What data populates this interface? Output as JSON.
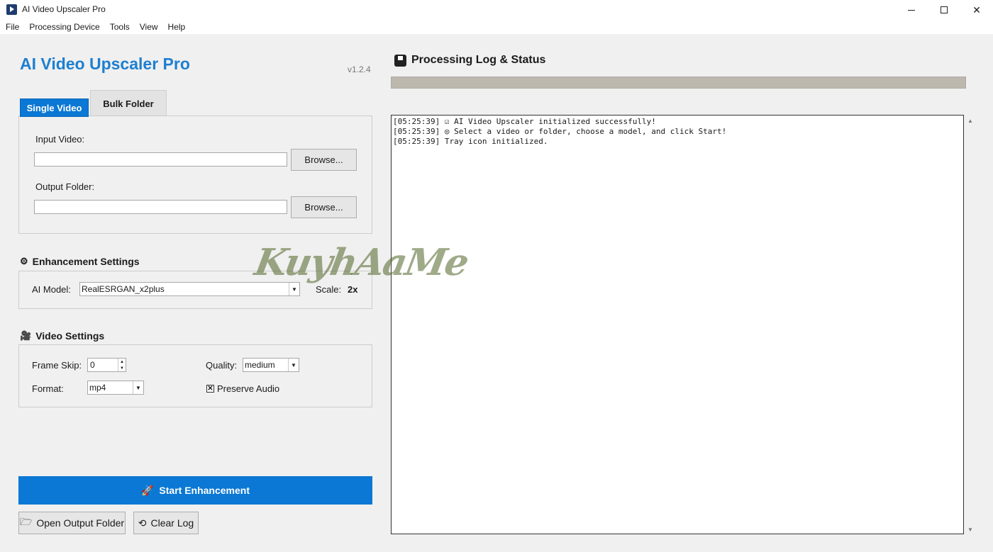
{
  "window": {
    "title": "AI Video Upscaler Pro"
  },
  "menu": [
    "File",
    "Processing Device",
    "Tools",
    "View",
    "Help"
  ],
  "header": {
    "title": "AI Video Upscaler Pro",
    "version": "v1.2.4"
  },
  "tabs": {
    "single": "Single Video",
    "bulk": "Bulk Folder"
  },
  "files": {
    "input_label": "Input Video:",
    "input_value": "",
    "output_label": "Output Folder:",
    "output_value": "",
    "browse_label": "Browse..."
  },
  "enhancement": {
    "title": "Enhancement Settings",
    "model_label": "AI Model:",
    "model_value": "RealESRGAN_x2plus",
    "scale_label": "Scale:",
    "scale_value": "2x"
  },
  "video": {
    "title": "Video Settings",
    "frame_skip_label": "Frame Skip:",
    "frame_skip_value": "0",
    "quality_label": "Quality:",
    "quality_value": "medium",
    "format_label": "Format:",
    "format_value": "mp4",
    "preserve_audio_label": "Preserve Audio",
    "preserve_audio_checked": true
  },
  "actions": {
    "start": "Start Enhancement",
    "open_output": "Open Output Folder",
    "clear_log": "Clear Log"
  },
  "log": {
    "title": "Processing Log & Status",
    "progress": 0,
    "lines": [
      "[05:25:39] ☑ AI Video Upscaler initialized successfully!",
      "[05:25:39] ◎ Select a video or folder, choose a model, and click Start!",
      "[05:25:39] Tray icon initialized."
    ]
  },
  "watermark": {
    "text": "KuyhAaMe"
  },
  "colors": {
    "accent": "#0a78d4",
    "heading": "#1e7fd0",
    "progress_track": "#bdb8ae"
  }
}
